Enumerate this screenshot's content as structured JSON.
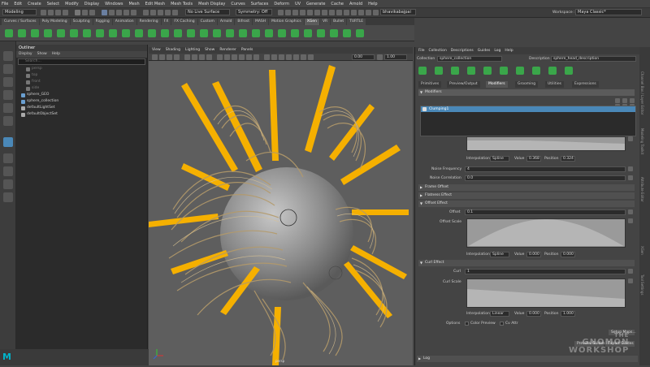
{
  "menubar": [
    "File",
    "Edit",
    "Create",
    "Select",
    "Modify",
    "Display",
    "Windows",
    "Mesh",
    "Edit Mesh",
    "Mesh Tools",
    "Mesh Display",
    "Curves",
    "Surfaces",
    "Deform",
    "UV",
    "Generate",
    "Cache",
    "Arnold",
    "Help"
  ],
  "status": {
    "mode": "Modeling",
    "live_surface": "No Live Surface",
    "symmetry": "Symmetry: Off",
    "user": "bhavikabajpai",
    "workspace_label": "Workspace :",
    "workspace": "Maya Classic*"
  },
  "shelf_tabs": [
    "Curves / Surfaces",
    "Poly Modeling",
    "Sculpting",
    "Rigging",
    "Animation",
    "Rendering",
    "FX",
    "FX Caching",
    "Custom",
    "Arnold",
    "Bifrost",
    "MASH",
    "Motion Graphics",
    "XGen",
    "VR",
    "Bullet",
    "TURTLE"
  ],
  "shelf_active": "XGen",
  "outliner": {
    "title": "Outliner",
    "menu": [
      "Display",
      "Show",
      "Help"
    ],
    "search_placeholder": "Search...",
    "items": [
      {
        "label": "persp",
        "dim": true
      },
      {
        "label": "top",
        "dim": true
      },
      {
        "label": "front",
        "dim": true
      },
      {
        "label": "side",
        "dim": true
      },
      {
        "label": "sphere_GEO",
        "dim": false
      },
      {
        "label": "sphere_collection",
        "dim": false
      },
      {
        "label": "defaultLightSet",
        "dim": false
      },
      {
        "label": "defaultObjectSet",
        "dim": false
      }
    ]
  },
  "viewport": {
    "menu": [
      "View",
      "Shading",
      "Lighting",
      "Show",
      "Renderer",
      "Panels"
    ],
    "value1": "0.00",
    "value2": "1.00",
    "camera_label": "persp"
  },
  "xgen": {
    "menu": [
      "File",
      "Collection",
      "Descriptions",
      "Guides",
      "Log",
      "Help"
    ],
    "collection_label": "Collection",
    "collection": "sphere_collection",
    "description_label": "Description",
    "description": "sphere_head_description",
    "tabs": [
      "Primitives",
      "Preview/Output",
      "Modifiers",
      "Grooming",
      "Utilities",
      "Expressions"
    ],
    "active_tab": "Modifiers",
    "modifiers_header": "Modifiers",
    "modifier_item": "Clumping1",
    "clump_interp_label": "Interpolation",
    "clump_interp": "Spline",
    "clump_value_label": "Value",
    "clump_value": "0.368",
    "clump_pos_label": "Position",
    "clump_pos": "0.324",
    "noise_freq_label": "Noise Frequency",
    "noise_freq": "4",
    "noise_corr_label": "Noise Correlation",
    "noise_corr": "0.0",
    "frame_offset": "Frame Offset",
    "flatness_effect": "Flatness Effect",
    "offset_effect": "Offset Effect",
    "offset_label": "Offset",
    "offset": "0.1",
    "offset_scale_label": "Offset Scale",
    "off_interp": "Spline",
    "off_value": "0.000",
    "off_pos": "0.000",
    "curl_effect": "Curl Effect",
    "curl_label": "Curl",
    "curl": "1",
    "curl_scale_label": "Curl Scale",
    "curl_interp": "Linear",
    "curl_value": "0.000",
    "curl_pos": "1.000",
    "options_label": "Options",
    "color_preview": "Color Preview",
    "cv_attr": "Cv Attr",
    "setup_maps": "Setup Maps...",
    "preview_guides": "Preview Guides",
    "export_guides": "Export Guides",
    "log": "Log"
  },
  "right_tabs": [
    "Channel Box / Layer Editor",
    "Modeling Toolkit",
    "Attribute Editor",
    "XGen",
    "Tool Settings"
  ],
  "watermark": [
    "THE",
    "GNOMON",
    "WORKSHOP"
  ],
  "logo": "M",
  "colors": {
    "accent": "#4a88b8",
    "bar": "#f5b000",
    "fur": "#b49a6a"
  }
}
